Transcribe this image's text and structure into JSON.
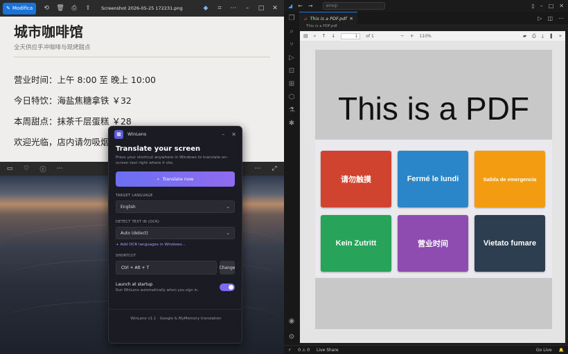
{
  "viewer": {
    "modify_label": "Modifica",
    "filename": "Screenshot 2026-05-25 172231.png",
    "photo": {
      "title": "城市咖啡馆",
      "subtitle": "全天供应手冲咖啡与现烤甜点",
      "lines": [
        "营业时间：上午 8:00 至 晚上 10:00",
        "今日特饮：海盐焦糖拿铁 ￥32",
        "本周甜点：抹茶千层蛋糕 ￥28",
        "欢迎光临，店内请勿吸烟"
      ]
    }
  },
  "winlens": {
    "app_name": "WinLens",
    "heading": "Translate your screen",
    "description": "Press your shortcut anywhere in Windows to translate on-screen text right where it sits.",
    "translate_button": "Translate now",
    "target_label": "TARGET LANGUAGE",
    "target_value": "English",
    "detect_label": "DETECT TEXT IN (OCR)",
    "detect_value": "Auto (detect)",
    "add_ocr_link": "+ Add OCR languages in Windows...",
    "shortcut_label": "SHORTCUT",
    "shortcut_keys": "Ctrl + Alt + T",
    "change_button": "Change",
    "startup_title": "Launch at startup",
    "startup_desc": "Run WinLens automatically when you sign in.",
    "startup_enabled": true,
    "footer": "WinLens v1.1 · Google & MyMemory translation"
  },
  "vscode": {
    "command_center": "emoji",
    "tab_label": "This is a PDF.pdf",
    "breadcrumb": "This is a PDF.pdf",
    "pdf_toolbar": {
      "page": "1",
      "of": "of 1",
      "zoom": "110%"
    },
    "pdf": {
      "title": "This is a PDF",
      "tiles": [
        {
          "label": "请勿触摸",
          "color": "#d0432e"
        },
        {
          "label": "Fermé le lundi",
          "color": "#2b86c9"
        },
        {
          "label": "Salida de emergencia",
          "color": "#f39c12"
        },
        {
          "label": "Kein Zutritt",
          "color": "#27a35a"
        },
        {
          "label": "营业时间",
          "color": "#8e4cb0"
        },
        {
          "label": "Vietato fumare",
          "color": "#2c3e50"
        }
      ]
    },
    "status": {
      "problems": "0 ⚠ 0",
      "live_share": "Live Share",
      "go_live": "Go Live"
    }
  }
}
